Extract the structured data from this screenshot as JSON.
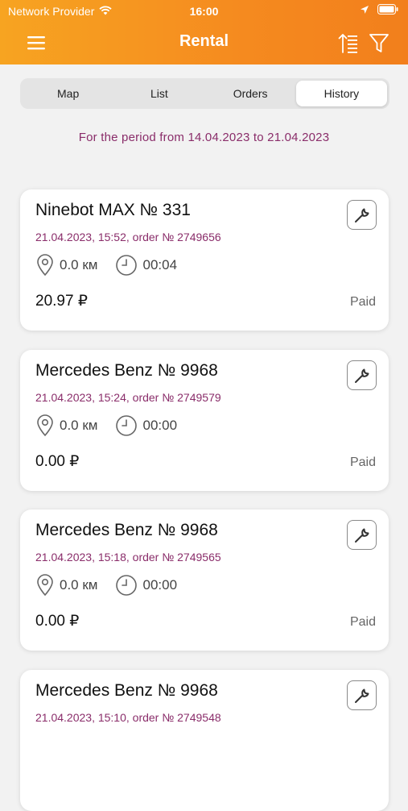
{
  "status_bar": {
    "carrier": "Network Provider",
    "time": "16:00"
  },
  "header": {
    "title": "Rental",
    "accent_color": "#f58a1f"
  },
  "tabs": [
    {
      "label": "Map",
      "active": false
    },
    {
      "label": "List",
      "active": false
    },
    {
      "label": "Orders",
      "active": false
    },
    {
      "label": "History",
      "active": true
    }
  ],
  "period_text": "For the period from 14.04.2023 to 21.04.2023",
  "rentals": [
    {
      "title": "Ninebot MAX № 331",
      "subtitle": "21.04.2023, 15:52, order № 2749656",
      "distance": "0.0 км",
      "duration": "00:04",
      "price": "20.97 ₽",
      "status": "Paid"
    },
    {
      "title": "Mercedes Benz № 9968",
      "subtitle": "21.04.2023, 15:24, order № 2749579",
      "distance": "0.0 км",
      "duration": "00:00",
      "price": "0.00 ₽",
      "status": "Paid"
    },
    {
      "title": "Mercedes Benz № 9968",
      "subtitle": "21.04.2023, 15:18, order № 2749565",
      "distance": "0.0 км",
      "duration": "00:00",
      "price": "0.00 ₽",
      "status": "Paid"
    },
    {
      "title": "Mercedes Benz № 9968",
      "subtitle": "21.04.2023, 15:10, order № 2749548",
      "distance": "",
      "duration": "",
      "price": "",
      "status": ""
    }
  ]
}
